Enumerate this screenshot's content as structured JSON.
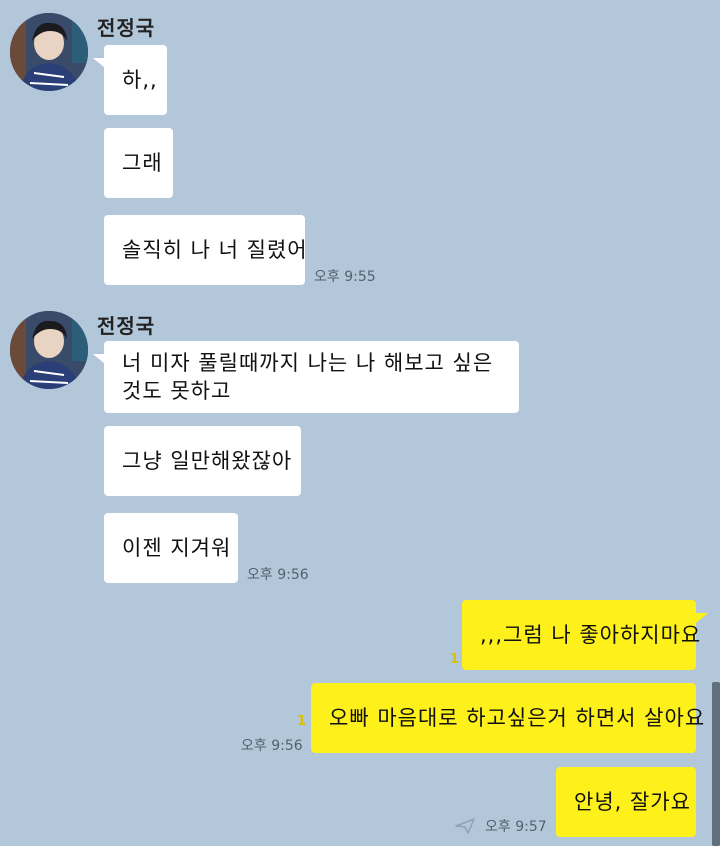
{
  "groups": [
    {
      "sender": "전정국",
      "avatar_icon": "profile-photo-avatar",
      "messages": [
        "하,,",
        "그래",
        "솔직히 나 너 질렸어"
      ],
      "time": "오후 9:55"
    },
    {
      "sender": "전정국",
      "avatar_icon": "profile-photo-avatar",
      "messages": [
        "너 미자 풀릴때까지 나는 나 해보고 싶은",
        "것도 못하고",
        "그냥 일만해왔잖아",
        "이젠 지겨워"
      ],
      "time": "오후 9:56"
    }
  ],
  "outgoing": [
    {
      "text": ",,,그럼 나 좋아하지마요",
      "unread": "1",
      "time": ""
    },
    {
      "text": "오빠 마음대로 하고싶은거 하면서 살아요",
      "unread": "1",
      "time": "오후 9:56"
    },
    {
      "text": "안녕, 잘가요",
      "unread": "",
      "time": "오후 9:57"
    }
  ],
  "colors": {
    "background": "#b2c7d9",
    "incoming_bubble": "#ffffff",
    "outgoing_bubble": "#fdf01b",
    "unread_count": "#d8c200"
  }
}
